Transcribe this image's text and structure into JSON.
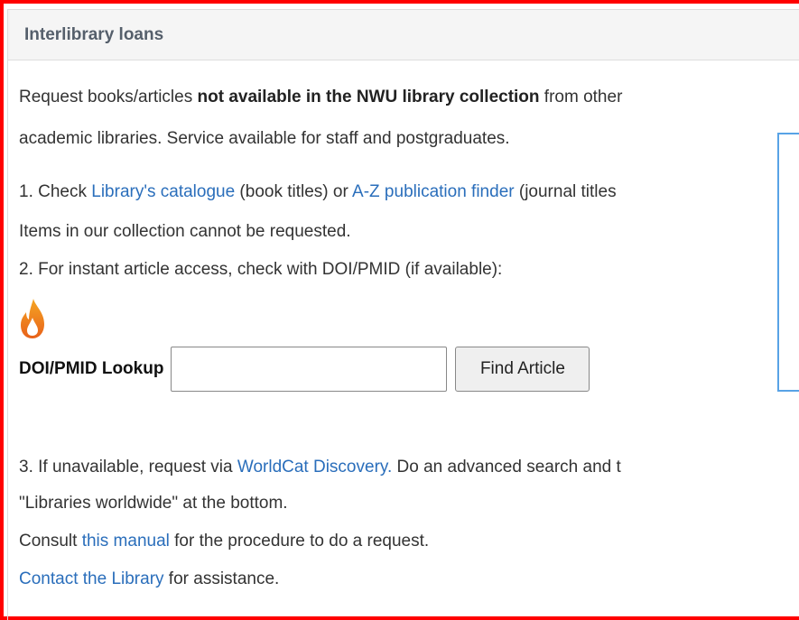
{
  "panel": {
    "title": "Interlibrary loans"
  },
  "intro": {
    "pre": "Request books/articles ",
    "bold": "not available in the NWU library collection",
    "post": " from other",
    "line2": "academic libraries.  Service available for staff and postgraduates."
  },
  "step1": {
    "num": "1.  Check ",
    "link1": "Library's catalogue",
    "mid": " (book titles) or ",
    "link2": "A-Z publication finder",
    "post": " (journal titles",
    "line2": "Items in our collection cannot be requested."
  },
  "step2": {
    "text": "2.  For instant article access, check with DOI/PMID (if available):"
  },
  "lookup": {
    "label": "DOI/PMID Lookup",
    "input_value": "",
    "input_placeholder": "",
    "button_label": "Find Article",
    "icon": "flame-icon"
  },
  "step3": {
    "pre": "3.  If unavailable, request via ",
    "link": "WorldCat Discovery.",
    "post": "  Do an advanced search and t",
    "line2": "\"Libraries worldwide\" at the bottom.",
    "consult_pre": "Consult ",
    "consult_link": "this manual",
    "consult_post": " for the procedure to do a request.",
    "contact_link": "Contact the Library",
    "contact_post": " for assistance."
  },
  "colors": {
    "link": "#2a6ebb",
    "frame": "#ff0000",
    "heading_bg": "#f5f5f5",
    "side_border": "#58a3e6"
  }
}
